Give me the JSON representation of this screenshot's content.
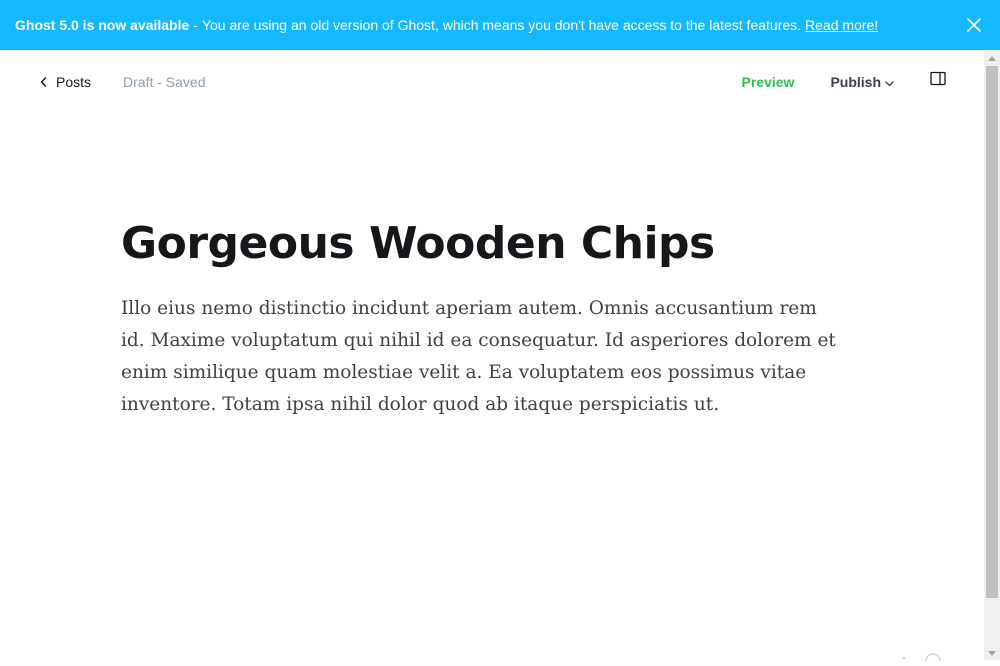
{
  "banner": {
    "strong_text": "Ghost 5.0 is now available",
    "separator": "-",
    "message": "You are using an old version of Ghost, which means you don't have access to the latest features.",
    "link_text": "Read more!",
    "background": "#14b8ff",
    "close_icon": "close-icon"
  },
  "header": {
    "back_label": "Posts",
    "back_icon": "chevron-left-icon",
    "status": "Draft - Saved",
    "preview_label": "Preview",
    "publish_label": "Publish",
    "publish_icon": "chevron-down-icon",
    "sidebar_icon": "sidebar-toggle-icon",
    "preview_color": "#30c04f"
  },
  "post": {
    "title": "Gorgeous Wooden Chips",
    "body": "Illo eius nemo distinctio incidunt aperiam autem. Omnis accusantium rem id. Maxime voluptatum qui nihil id ea consequatur. Id asperiores dolorem et enim similique quam molestiae velit a. Ea voluptatem eos possimus vitae inventore. Totam ipsa nihil dolor quod ab itaque perspiciatis ut."
  }
}
